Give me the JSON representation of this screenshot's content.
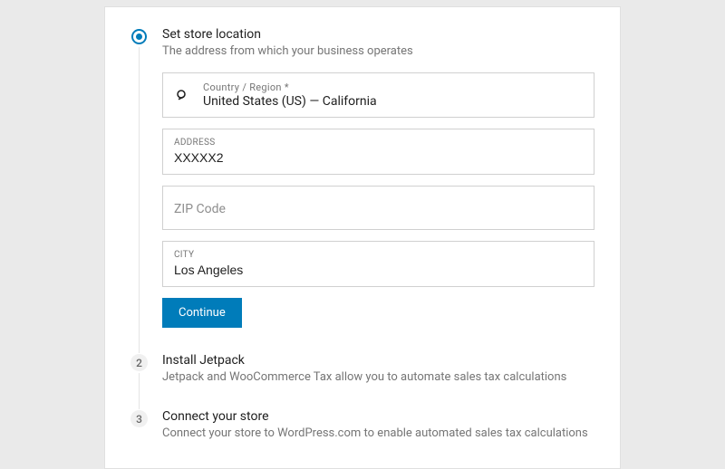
{
  "steps": [
    {
      "title": "Set store location",
      "desc": "The address from which your business operates",
      "form": {
        "country": {
          "label": "Country / Region *",
          "value": "United States (US) — California"
        },
        "address": {
          "label": "Address",
          "value": "XXXXX2"
        },
        "zip": {
          "placeholder": "ZIP Code",
          "value": ""
        },
        "city": {
          "label": "City",
          "value": "Los Angeles"
        },
        "continue": "Continue"
      }
    },
    {
      "number": "2",
      "title": "Install Jetpack",
      "desc": "Jetpack and WooCommerce Tax allow you to automate sales tax calculations"
    },
    {
      "number": "3",
      "title": "Connect your store",
      "desc": "Connect your store to WordPress.com to enable automated sales tax calculations"
    }
  ]
}
